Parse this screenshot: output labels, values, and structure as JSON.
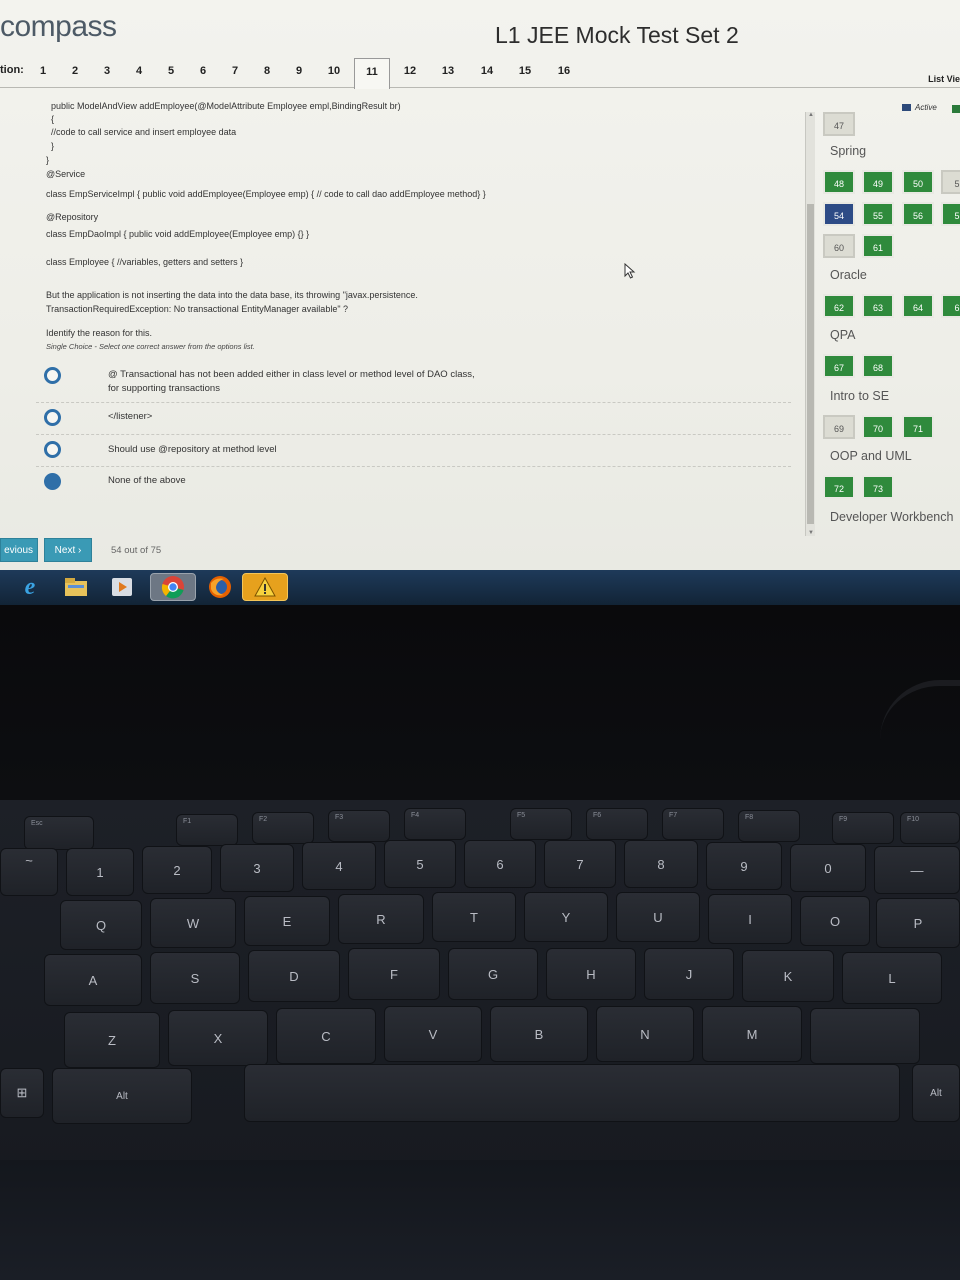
{
  "header": {
    "logo": "compass",
    "title": "L1 JEE Mock Test Set 2"
  },
  "question_nav": {
    "label": "tion:",
    "numbers": [
      "1",
      "2",
      "3",
      "4",
      "5",
      "6",
      "7",
      "8",
      "9",
      "10",
      "11",
      "12",
      "13",
      "14",
      "15",
      "16"
    ],
    "current": "11",
    "list_view": "List Vie"
  },
  "question": {
    "code_lines": [
      "public ModelAndView addEmployee(@ModelAttribute Employee empl,BindingResult br)",
      "{",
      "//code to call service and insert employee data",
      "}",
      "}",
      "@Service",
      "class EmpServiceImpl {  public void addEmployee(Employee emp) { // code to call dao addEmployee method} }",
      "@Repository",
      "class EmpDaoImpl {  public void addEmployee(Employee emp) {} }",
      "class Employee { //variables, getters and setters }",
      "But the application is not inserting the data into the data base, its throwing \"javax.persistence.",
      "TransactionRequiredException: No transactional EntityManager available\" ?",
      "Identify the reason for this."
    ],
    "instruction": "Single Choice - Select one correct answer from the options list.",
    "options": [
      {
        "line1": "@ Transactional has not been added either in class level or method level of DAO class,",
        "line2": "for supporting transactions",
        "selected": false
      },
      {
        "line1": "</listener>",
        "line2": "",
        "selected": false
      },
      {
        "line1": "Should use @repository at method level",
        "line2": "",
        "selected": false
      },
      {
        "line1": "None of the above",
        "line2": "",
        "selected": true
      }
    ]
  },
  "legend": {
    "active_label": "Active"
  },
  "palette": {
    "sections": [
      {
        "name": "Spring"
      },
      {
        "name": "Oracle"
      },
      {
        "name": "QPA"
      },
      {
        "name": "Intro to SE"
      },
      {
        "name": "OOP and UML"
      },
      {
        "name": "Developer Workbench"
      }
    ],
    "tiles": {
      "t47": "47",
      "t48": "48",
      "t49": "49",
      "t50": "50",
      "t51": "5",
      "t54": "54",
      "t55": "55",
      "t56": "56",
      "t57": "5",
      "t60": "60",
      "t61": "61",
      "t62": "62",
      "t63": "63",
      "t64": "64",
      "t65": "6",
      "t67": "67",
      "t68": "68",
      "t69": "69",
      "t70": "70",
      "t71": "71",
      "t72": "72",
      "t73": "73"
    }
  },
  "footer": {
    "previous": "evious",
    "next": "Next ›",
    "progress": "54 out of 75"
  },
  "taskbar": {
    "icons": [
      "internet-explorer-icon",
      "file-explorer-icon",
      "media-player-icon",
      "chrome-icon",
      "firefox-icon",
      "warning-icon"
    ]
  },
  "keyboard": {
    "function_row": [
      "Esc",
      "F1",
      "F2",
      "F3",
      "F4",
      "F5",
      "F6",
      "F7",
      "F8",
      "F9",
      "F10"
    ],
    "number_row": [
      "~",
      "!",
      "@",
      "#",
      "$",
      "%",
      "^",
      "&",
      "*",
      "(",
      ")",
      "—"
    ],
    "number_row_lower": [
      "",
      "1",
      "2",
      "3",
      "4",
      "5",
      "6",
      "7",
      "8",
      "9",
      "0",
      ""
    ],
    "row_q": [
      "Q",
      "W",
      "E",
      "R",
      "T",
      "Y",
      "U",
      "I",
      "O",
      "P"
    ],
    "row_a": [
      "A",
      "S",
      "D",
      "F",
      "G",
      "H",
      "J",
      "K",
      "L"
    ],
    "row_z": [
      "Z",
      "X",
      "C",
      "V",
      "B",
      "N",
      "M"
    ],
    "alt": "Alt",
    "alt_right": "Alt"
  }
}
